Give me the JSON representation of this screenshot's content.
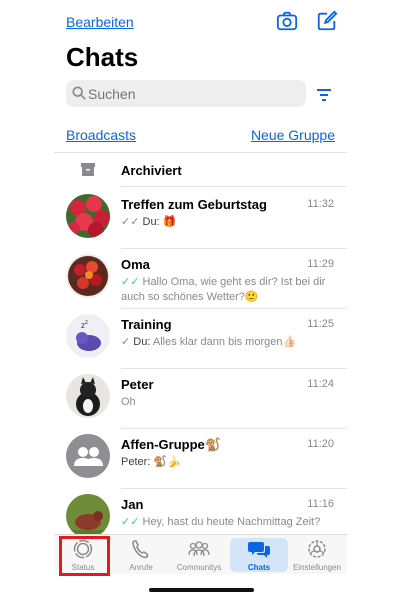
{
  "header": {
    "edit_label": "Bearbeiten",
    "title": "Chats",
    "camera_icon": "camera-icon",
    "compose_icon": "compose-icon"
  },
  "search": {
    "placeholder": "Suchen"
  },
  "links": {
    "broadcasts": "Broadcasts",
    "new_group": "Neue Gruppe"
  },
  "archived": {
    "label": "Archiviert"
  },
  "chats": [
    {
      "name": "Treffen zum Geburtstag",
      "time": "11:32",
      "tick": "✓✓",
      "tick_read": false,
      "sender": "Du:",
      "message": "🎁"
    },
    {
      "name": "Oma",
      "time": "11:29",
      "tick": "✓✓",
      "tick_read": true,
      "sender": "",
      "message": "Hallo Oma, wie geht es dir? Ist bei dir auch so schönes Wetter?🙂"
    },
    {
      "name": "Training",
      "time": "11:25",
      "tick": "✓",
      "tick_read": false,
      "sender": "Du:",
      "message": "Alles klar dann bis morgen👍🏻"
    },
    {
      "name": "Peter",
      "time": "11:24",
      "tick": "",
      "tick_read": false,
      "sender": "",
      "message": "Oh"
    },
    {
      "name": "Affen-Gruppe🐒",
      "time": "11:20",
      "tick": "",
      "tick_read": false,
      "sender": "Peter:",
      "message": "🐒🍌"
    },
    {
      "name": "Jan",
      "time": "11:16",
      "tick": "✓✓",
      "tick_read": true,
      "sender": "",
      "message": "Hey, hast du heute Nachmittag Zeit?"
    }
  ],
  "tabs": [
    {
      "label": "Status",
      "icon": "status-icon",
      "active": false
    },
    {
      "label": "Anrufe",
      "icon": "phone-icon",
      "active": false
    },
    {
      "label": "Communitys",
      "icon": "communities-icon",
      "active": false
    },
    {
      "label": "Chats",
      "icon": "chats-icon",
      "active": true
    },
    {
      "label": "Einstellungen",
      "icon": "settings-icon",
      "active": false
    }
  ],
  "colors": {
    "accent": "#0b66e4",
    "read_tick": "#34b7f1",
    "highlight": "#e01b1b"
  }
}
